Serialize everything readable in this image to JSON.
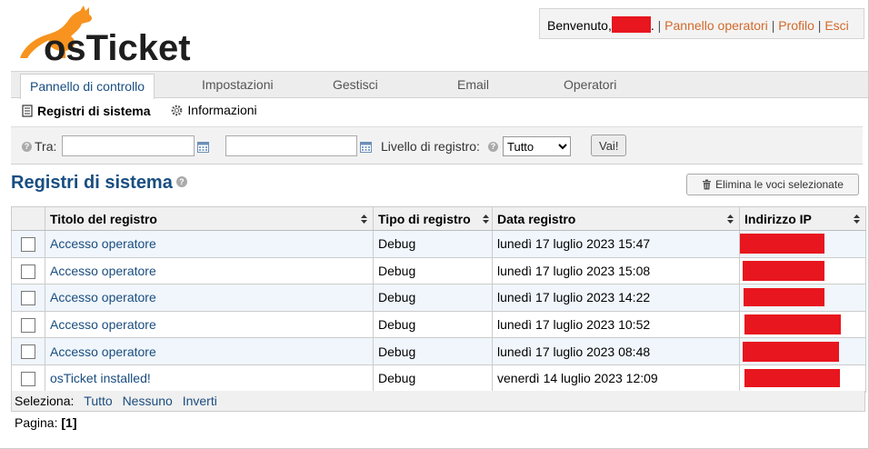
{
  "app": {
    "logo_text": "osTicket"
  },
  "header": {
    "welcome": "Benvenuto,",
    "welcome_suffix": ".",
    "links": [
      "Pannello operatori",
      "Profilo",
      "Esci"
    ],
    "separator": "|"
  },
  "nav": {
    "tabs": [
      {
        "label": "Pannello di controllo",
        "active": true
      },
      {
        "label": "Impostazioni"
      },
      {
        "label": "Gestisci"
      },
      {
        "label": "Email"
      },
      {
        "label": "Operatori"
      }
    ]
  },
  "subnav": {
    "items": [
      {
        "label": "Registri di sistema",
        "icon": "document-icon",
        "active": true
      },
      {
        "label": "Informazioni",
        "icon": "gear-icon"
      }
    ]
  },
  "filter": {
    "between_label": "Tra:",
    "from_value": "",
    "to_value": "",
    "level_label": "Livello di registro:",
    "level_selected": "Tutto",
    "go_label": "Vai!"
  },
  "page": {
    "title": "Registri di sistema",
    "delete_button": "Elimina le voci selezionate"
  },
  "table": {
    "columns": [
      "Titolo del registro",
      "Tipo di registro",
      "Data registro",
      "Indirizzo IP"
    ],
    "rows": [
      {
        "title": "Accesso operatore",
        "type": "Debug",
        "date": "lunedì 17 luglio 2023 15:47"
      },
      {
        "title": "Accesso operatore",
        "type": "Debug",
        "date": "lunedì 17 luglio 2023 15:08"
      },
      {
        "title": "Accesso operatore",
        "type": "Debug",
        "date": "lunedì 17 luglio 2023 14:22"
      },
      {
        "title": "Accesso operatore",
        "type": "Debug",
        "date": "lunedì 17 luglio 2023 10:52"
      },
      {
        "title": "Accesso operatore",
        "type": "Debug",
        "date": "lunedì 17 luglio 2023 08:48"
      },
      {
        "title": "osTicket installed!",
        "type": "Debug",
        "date": "venerdì 14 luglio 2023 12:09"
      }
    ]
  },
  "selection": {
    "label": "Seleziona:",
    "all": "Tutto",
    "none": "Nessuno",
    "invert": "Inverti"
  },
  "pagination": {
    "label": "Pagina:",
    "current": "[1]"
  },
  "colors": {
    "brand_orange": "#f7931e",
    "dark_text": "#1e1e1e",
    "link_blue": "#1a4d7f",
    "title_blue": "#184e81",
    "header_link_orange": "#d2692a",
    "redaction_red": "#e8161e",
    "row_alt": "#f0f6fb"
  }
}
